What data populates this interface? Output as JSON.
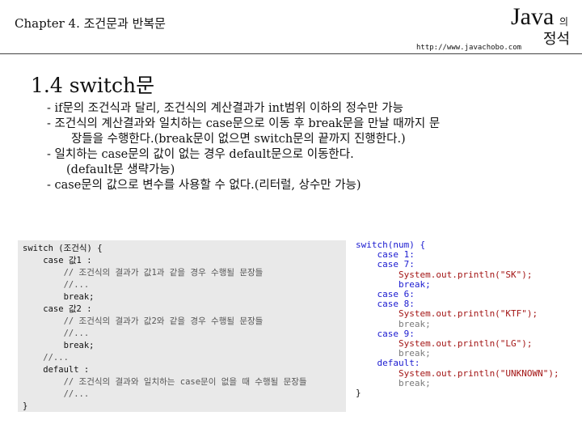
{
  "header": {
    "chapter": "Chapter 4. 조건문과 반복문",
    "java": "Java",
    "ui": "의",
    "jeongseok": "정석",
    "url": "http://www.javachobo.com"
  },
  "title": "1.4 switch문",
  "bullets": [
    "- if문의 조건식과 달리, 조건식의 계산결과가 int범위 이하의 정수만 가능",
    "- 조건식의 계산결과와 일치하는 case문으로 이동 후 break문을 만날 때까지 문",
    "장들을 수행한다.(break문이 없으면 switch문의 끝까지 진행한다.)",
    "- 일치하는 case문의 값이 없는 경우 default문으로 이동한다.",
    "(default문 생략가능)",
    "- case문의 값으로 변수를 사용할 수 없다.(리터럴, 상수만 가능)"
  ],
  "code_left": [
    "switch (조건식) {",
    "    case 값1 :",
    "        // 조건식의 결과가 값1과 같을 경우 수행될 문장들",
    "        //...",
    "        break;",
    "    case 값2 :",
    "        // 조건식의 결과가 값2와 같을 경우 수행될 문장들",
    "        //...",
    "        break;",
    "    //...",
    "    default :",
    "        // 조건식의 결과와 일치하는 case문이 없을 때 수행될 문장들",
    "        //...",
    "}"
  ],
  "code_right": [
    "switch(num) {",
    "    case 1:",
    "    case 7:",
    "        System.out.println(\"SK\");",
    "        break;",
    "    case 6:",
    "    case 8:",
    "        System.out.println(\"KTF\");",
    "        break;",
    "    case 9:",
    "        System.out.println(\"LG\");",
    "        break;",
    "    default:",
    "        System.out.println(\"UNKNOWN\");",
    "        break;",
    "}"
  ],
  "colors": {
    "code_keyword": "#1a1ad0",
    "code_system": "#a31515",
    "code_break": "#7a7a7a",
    "code_left_bg": "#e9e9e9"
  }
}
